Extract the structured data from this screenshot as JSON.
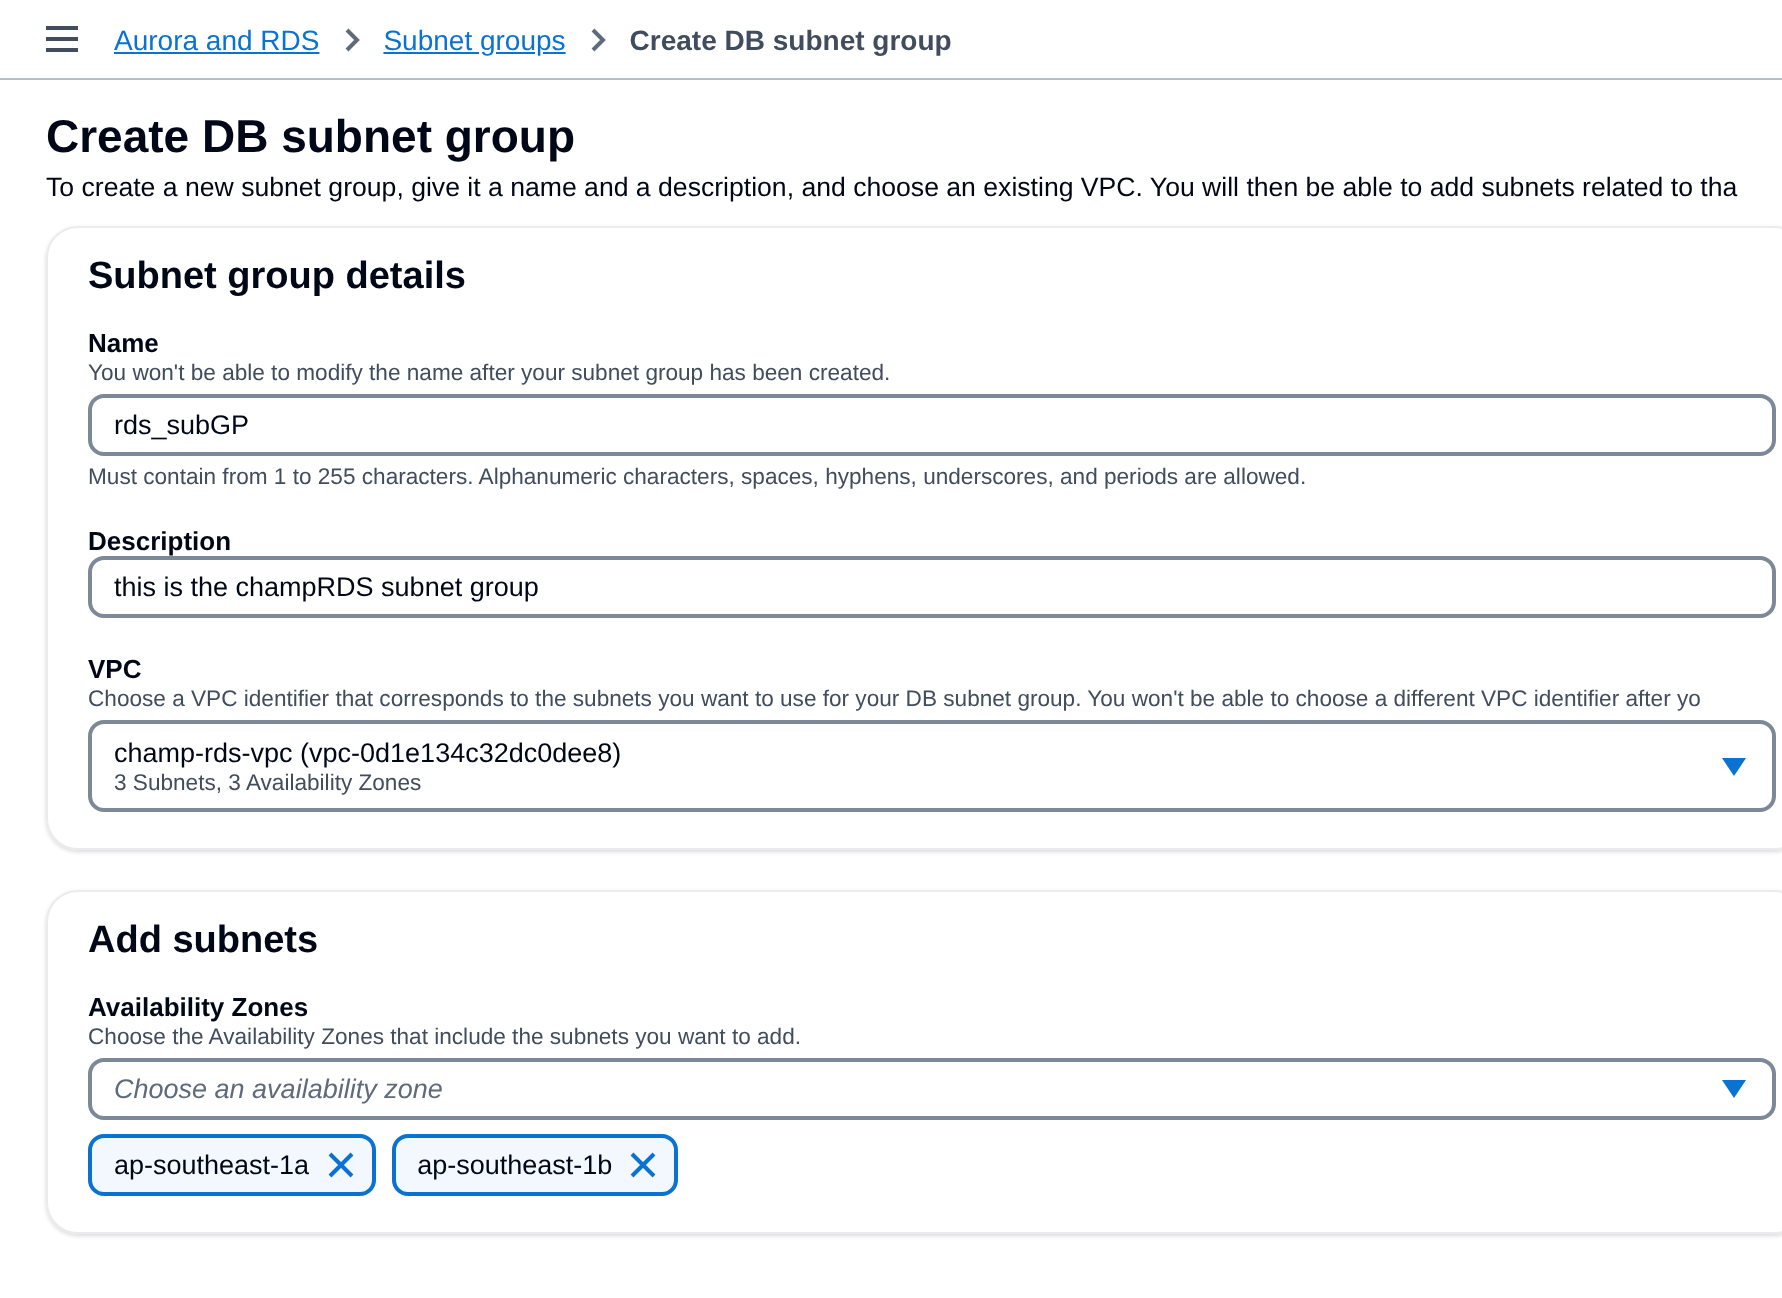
{
  "breadcrumbs": [
    {
      "label": "Aurora and RDS",
      "kind": "link"
    },
    {
      "label": "Subnet groups",
      "kind": "link"
    },
    {
      "label": "Create DB subnet group",
      "kind": "current"
    }
  ],
  "page": {
    "title": "Create DB subnet group",
    "description": "To create a new subnet group, give it a name and a description, and choose an existing VPC. You will then be able to add subnets related to tha"
  },
  "sections": [
    {
      "title": "Subnet group details",
      "fields": [
        {
          "kind": "text",
          "label": "Name",
          "description": "You won't be able to modify the name after your subnet group has been created.",
          "value": "rds_subGP",
          "constraint": "Must contain from 1 to 255 characters. Alphanumeric characters, spaces, hyphens, underscores, and periods are allowed."
        },
        {
          "kind": "text",
          "label": "Description",
          "value": "this is the champRDS subnet group"
        },
        {
          "kind": "select",
          "label": "VPC",
          "description": "Choose a VPC identifier that corresponds to the subnets you want to use for your DB subnet group. You won't be able to choose a different VPC identifier after yo",
          "value": "champ-rds-vpc (vpc-0d1e134c32dc0dee8)",
          "secondary": "3 Subnets, 3 Availability Zones"
        }
      ]
    },
    {
      "title": "Add subnets",
      "fields": [
        {
          "kind": "multiselect",
          "label": "Availability Zones",
          "description": "Choose the Availability Zones that include the subnets you want to add.",
          "placeholder": "Choose an availability zone",
          "tokens": [
            "ap-southeast-1a",
            "ap-southeast-1b"
          ]
        }
      ]
    }
  ]
}
